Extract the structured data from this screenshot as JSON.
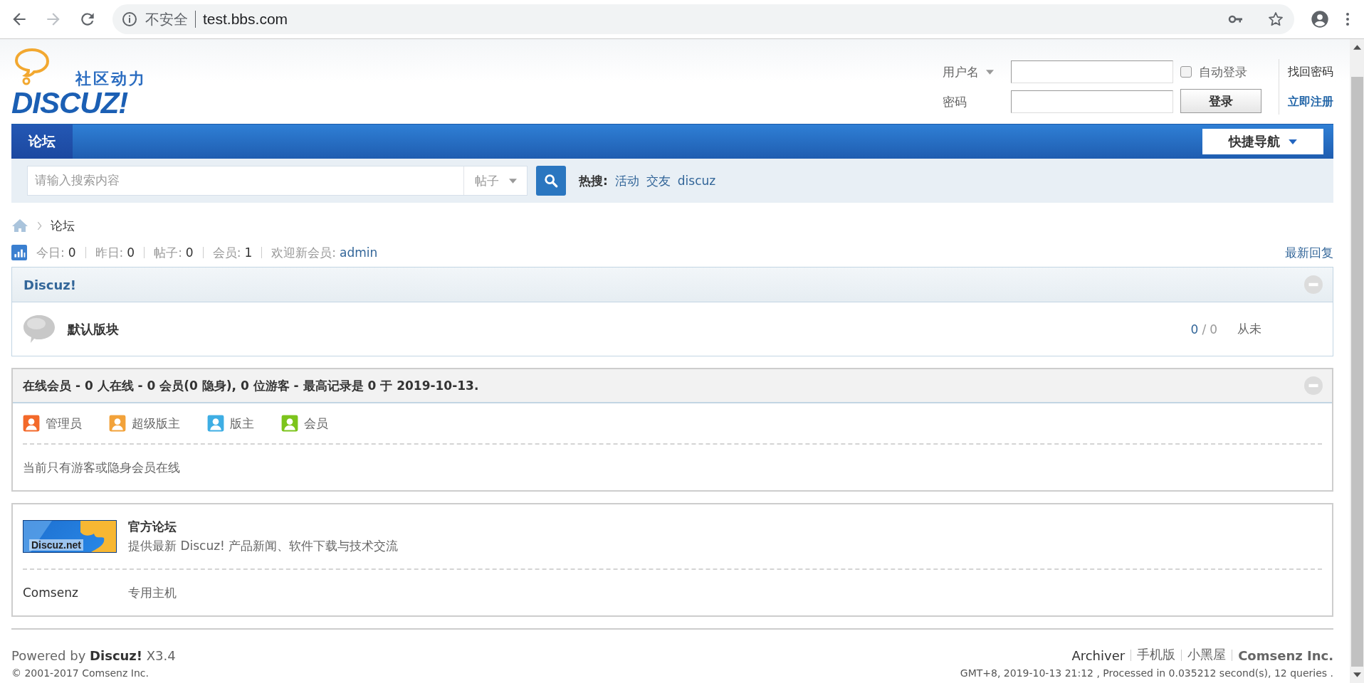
{
  "browser": {
    "security": "不安全",
    "url": "test.bbs.com"
  },
  "header": {
    "logo": {
      "tagline": "社区动力",
      "wordmark": "DISCUZ!"
    },
    "login": {
      "username_label": "用户名",
      "password_label": "密码",
      "auto_login": {
        "label": "自动登录",
        "checked": false
      },
      "login_button": "登录",
      "forgot": "找回密码",
      "register": "立即注册"
    }
  },
  "nav": {
    "tabs": [
      {
        "label": "论坛",
        "selected": true
      }
    ],
    "quick_nav": "快捷导航"
  },
  "search": {
    "placeholder": "请输入搜索内容",
    "type": "帖子",
    "hot_label": "热搜:",
    "hot": [
      "活动",
      "交友",
      "discuz"
    ]
  },
  "breadcrumb": [
    "论坛"
  ],
  "stats": {
    "items": [
      {
        "label": "今日:",
        "value": "0"
      },
      {
        "label": "昨日:",
        "value": "0"
      },
      {
        "label": "帖子:",
        "value": "0"
      },
      {
        "label": "会员:",
        "value": "1"
      }
    ],
    "new_member_label": "欢迎新会员:",
    "new_member": "admin",
    "latest_replies": "最新回复"
  },
  "category": {
    "title": "Discuz!",
    "forums": [
      {
        "name": "默认版块",
        "threads": "0",
        "separator": "/",
        "posts": "0",
        "last_post": "从未"
      }
    ]
  },
  "online": {
    "title": "在线会员 - 0 人在线 - 0 会员(0 隐身), 0 位游客 - 最高记录是 0 于 2019-10-13.",
    "legend": [
      {
        "label": "管理员",
        "color": "#f3692a"
      },
      {
        "label": "超级版主",
        "color": "#f2a23a"
      },
      {
        "label": "版主",
        "color": "#3eaee4"
      },
      {
        "label": "会员",
        "color": "#7cc41c"
      }
    ],
    "note": "当前只有游客或隐身会员在线"
  },
  "links": {
    "banner": "Discuz.net",
    "name": "官方论坛",
    "description": "提供最新 Discuz! 产品新闻、软件下载与技术交流",
    "text_links": [
      "Comsenz",
      "专用主机"
    ]
  },
  "footer": {
    "powered": "Powered by **Discuz!** X3.4",
    "copyright": "© 2001-2017 Comsenz Inc.",
    "links": [
      {
        "label": "Archiver",
        "strong": false
      },
      {
        "label": "手机版",
        "strong": false
      },
      {
        "label": "小黑屋",
        "strong": false
      },
      {
        "label": "Comsenz Inc.",
        "strong": true
      }
    ],
    "stats": "GMT+8, 2019-10-13 21:12 , Processed in 0.035212 second(s), 12 queries ."
  }
}
